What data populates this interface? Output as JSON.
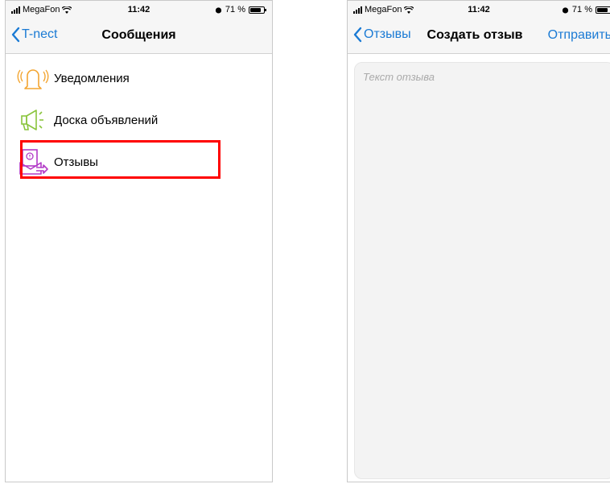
{
  "left_screen": {
    "status": {
      "carrier": "MegaFon",
      "time": "11:42",
      "battery": "71 %"
    },
    "nav": {
      "back_label": "T-nect",
      "title": "Сообщения"
    },
    "items": [
      {
        "label": "Уведомления",
        "icon": "bell-icon",
        "color": "#f3a531"
      },
      {
        "label": "Доска объявлений",
        "icon": "megaphone-icon",
        "color": "#8ac53e"
      },
      {
        "label": "Отзывы",
        "icon": "feedback-icon",
        "color": "#b23ac7"
      }
    ],
    "highlight_color": "#ff0000"
  },
  "right_screen": {
    "status": {
      "carrier": "MegaFon",
      "time": "11:42",
      "battery": "71 %"
    },
    "nav": {
      "back_label": "Отзывы",
      "title": "Создать отзыв",
      "action_label": "Отправить"
    },
    "feedback": {
      "placeholder": "Текст отзыва"
    }
  },
  "accent_color": "#1a7ad4"
}
